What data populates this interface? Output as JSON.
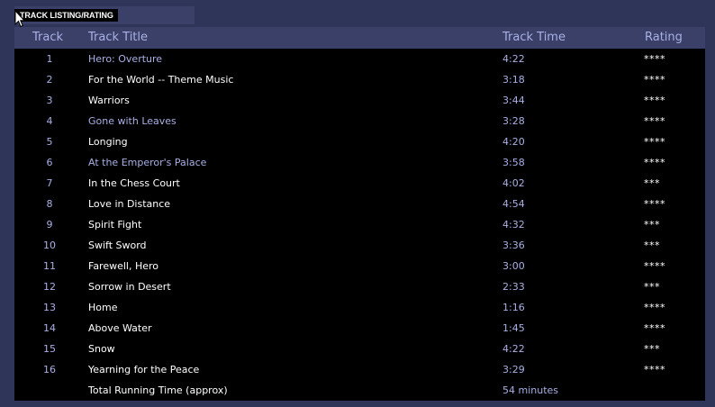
{
  "page": {
    "tab_label": "TRACK LISTING/RATING"
  },
  "table": {
    "headers": {
      "track": "Track",
      "title": "Track Title",
      "time": "Track Time",
      "rating": "Rating"
    },
    "rows": [
      {
        "num": "1",
        "title": "Hero:  Overture",
        "time": "4:22",
        "rating": "****",
        "highlight": true
      },
      {
        "num": "2",
        "title": "For the World -- Theme Music",
        "time": "3:18",
        "rating": "****",
        "highlight": false
      },
      {
        "num": "3",
        "title": "Warriors",
        "time": "3:44",
        "rating": "****",
        "highlight": false
      },
      {
        "num": "4",
        "title": "Gone with Leaves",
        "time": "3:28",
        "rating": "****",
        "highlight": true
      },
      {
        "num": "5",
        "title": "Longing",
        "time": "4:20",
        "rating": "****",
        "highlight": false
      },
      {
        "num": "6",
        "title": "At the Emperor's Palace",
        "time": "3:58",
        "rating": "****",
        "highlight": true
      },
      {
        "num": "7",
        "title": "In the Chess Court",
        "time": "4:02",
        "rating": "***",
        "highlight": false
      },
      {
        "num": "8",
        "title": "Love in Distance",
        "time": "4:54",
        "rating": "****",
        "highlight": false
      },
      {
        "num": "9",
        "title": "Spirit Fight",
        "time": "4:32",
        "rating": "***",
        "highlight": false
      },
      {
        "num": "10",
        "title": "Swift Sword",
        "time": "3:36",
        "rating": "***",
        "highlight": false
      },
      {
        "num": "11",
        "title": "Farewell, Hero",
        "time": "3:00",
        "rating": "****",
        "highlight": false
      },
      {
        "num": "12",
        "title": "Sorrow in Desert",
        "time": "2:33",
        "rating": "***",
        "highlight": false
      },
      {
        "num": "13",
        "title": "Home",
        "time": "1:16",
        "rating": "****",
        "highlight": false
      },
      {
        "num": "14",
        "title": "Above Water",
        "time": "1:45",
        "rating": "****",
        "highlight": false
      },
      {
        "num": "15",
        "title": "Snow",
        "time": "4:22",
        "rating": "***",
        "highlight": false
      },
      {
        "num": "16",
        "title": "Yearning for the Peace",
        "time": "3:29",
        "rating": "****",
        "highlight": false
      }
    ],
    "total": {
      "label": "Total Running Time (approx)",
      "value": "54 minutes"
    }
  },
  "colors": {
    "page_background": "#2f3459",
    "header_background": "#3b4068",
    "panel_background": "#000000",
    "accent_text": "#a8b0e4",
    "primary_text": "#ffffff"
  },
  "icons": {
    "pointer": "arrow-cursor-icon"
  }
}
